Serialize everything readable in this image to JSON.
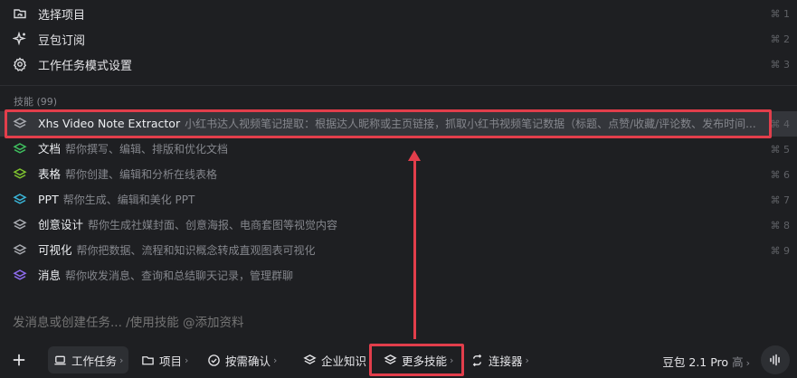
{
  "menu": [
    {
      "label": "选择项目",
      "shortcut": "⌘ 1",
      "icon": "folder-refresh-icon"
    },
    {
      "label": "豆包订阅",
      "shortcut": "⌘ 2",
      "icon": "sparkle-icon"
    },
    {
      "label": "工作任务模式设置",
      "shortcut": "⌘ 3",
      "icon": "gear-icon"
    }
  ],
  "skills_section": {
    "title": "技能 (99)"
  },
  "skills": [
    {
      "name": "Xhs Video Note Extractor",
      "desc": "小红书达人视频笔记提取：根据达人昵称或主页链接，抓取小红书视频笔记数据（标题、点赞/收藏/评论数、发布时间...",
      "shortcut": "⌘ 4",
      "color": "#a8aab0"
    },
    {
      "name": "文档",
      "desc": "帮你撰写、编辑、排版和优化文档",
      "shortcut": "⌘ 5",
      "color": "#3fbf5f"
    },
    {
      "name": "表格",
      "desc": "帮你创建、编辑和分析在线表格",
      "shortcut": "⌘ 6",
      "color": "#7fc42f"
    },
    {
      "name": "PPT",
      "desc": "帮你生成、编辑和美化 PPT",
      "shortcut": "⌘ 7",
      "color": "#3ab5d8"
    },
    {
      "name": "创意设计",
      "desc": "帮你生成社媒封面、创意海报、电商套图等视觉内容",
      "shortcut": "⌘ 8",
      "color": "#a8aab0"
    },
    {
      "name": "可视化",
      "desc": "帮你把数据、流程和知识概念转成直观图表可视化",
      "shortcut": "⌘ 9",
      "color": "#a8aab0"
    },
    {
      "name": "消息",
      "desc": "帮你收发消息、查询和总结聊天记录，管理群聊",
      "shortcut": "",
      "color": "#8f6cf0"
    }
  ],
  "input": {
    "placeholder": "发消息或创建任务... /使用技能 @添加资料"
  },
  "toolbar": {
    "work_task": "工作任务",
    "project": "项目",
    "confirm": "按需确认",
    "knowledge": "企业知识",
    "more_skills": "更多技能",
    "connector": "连接器",
    "chevron": "›"
  },
  "model": {
    "name": "豆包 2.1 Pro",
    "tier": "高"
  },
  "colors": {
    "background": "#1e1f22",
    "selected_row": "#34363b",
    "annotation": "#e23e4b"
  }
}
